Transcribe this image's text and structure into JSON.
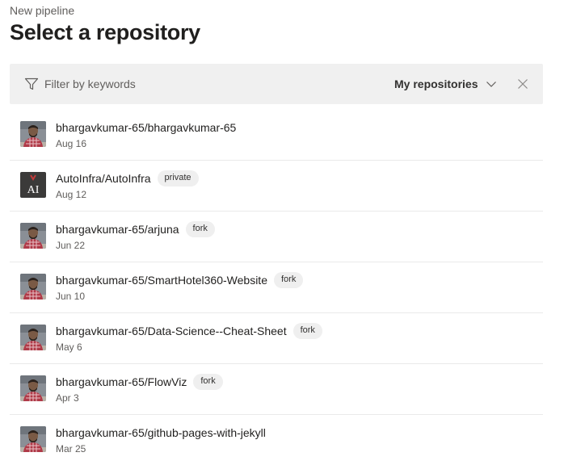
{
  "header": {
    "breadcrumb": "New pipeline",
    "title": "Select a repository"
  },
  "filter": {
    "placeholder": "Filter by keywords",
    "scope_label": "My repositories",
    "icons": {
      "filter": "filter-icon",
      "dropdown": "chevron-down-icon",
      "clear": "close-icon"
    }
  },
  "repositories": [
    {
      "name": "bhargavkumar-65/bhargavkumar-65",
      "date": "Aug 16",
      "badge": "",
      "avatar": "user-avatar"
    },
    {
      "name": "AutoInfra/AutoInfra",
      "date": "Aug 12",
      "badge": "private",
      "avatar": "org-avatar-AI"
    },
    {
      "name": "bhargavkumar-65/arjuna",
      "date": "Jun 22",
      "badge": "fork",
      "avatar": "user-avatar"
    },
    {
      "name": "bhargavkumar-65/SmartHotel360-Website",
      "date": "Jun 10",
      "badge": "fork",
      "avatar": "user-avatar"
    },
    {
      "name": "bhargavkumar-65/Data-Science--Cheat-Sheet",
      "date": "May 6",
      "badge": "fork",
      "avatar": "user-avatar"
    },
    {
      "name": "bhargavkumar-65/FlowViz",
      "date": "Apr 3",
      "badge": "fork",
      "avatar": "user-avatar"
    },
    {
      "name": "bhargavkumar-65/github-pages-with-jekyll",
      "date": "Mar 25",
      "badge": "",
      "avatar": "user-avatar"
    }
  ],
  "org_avatar_text": "AI"
}
